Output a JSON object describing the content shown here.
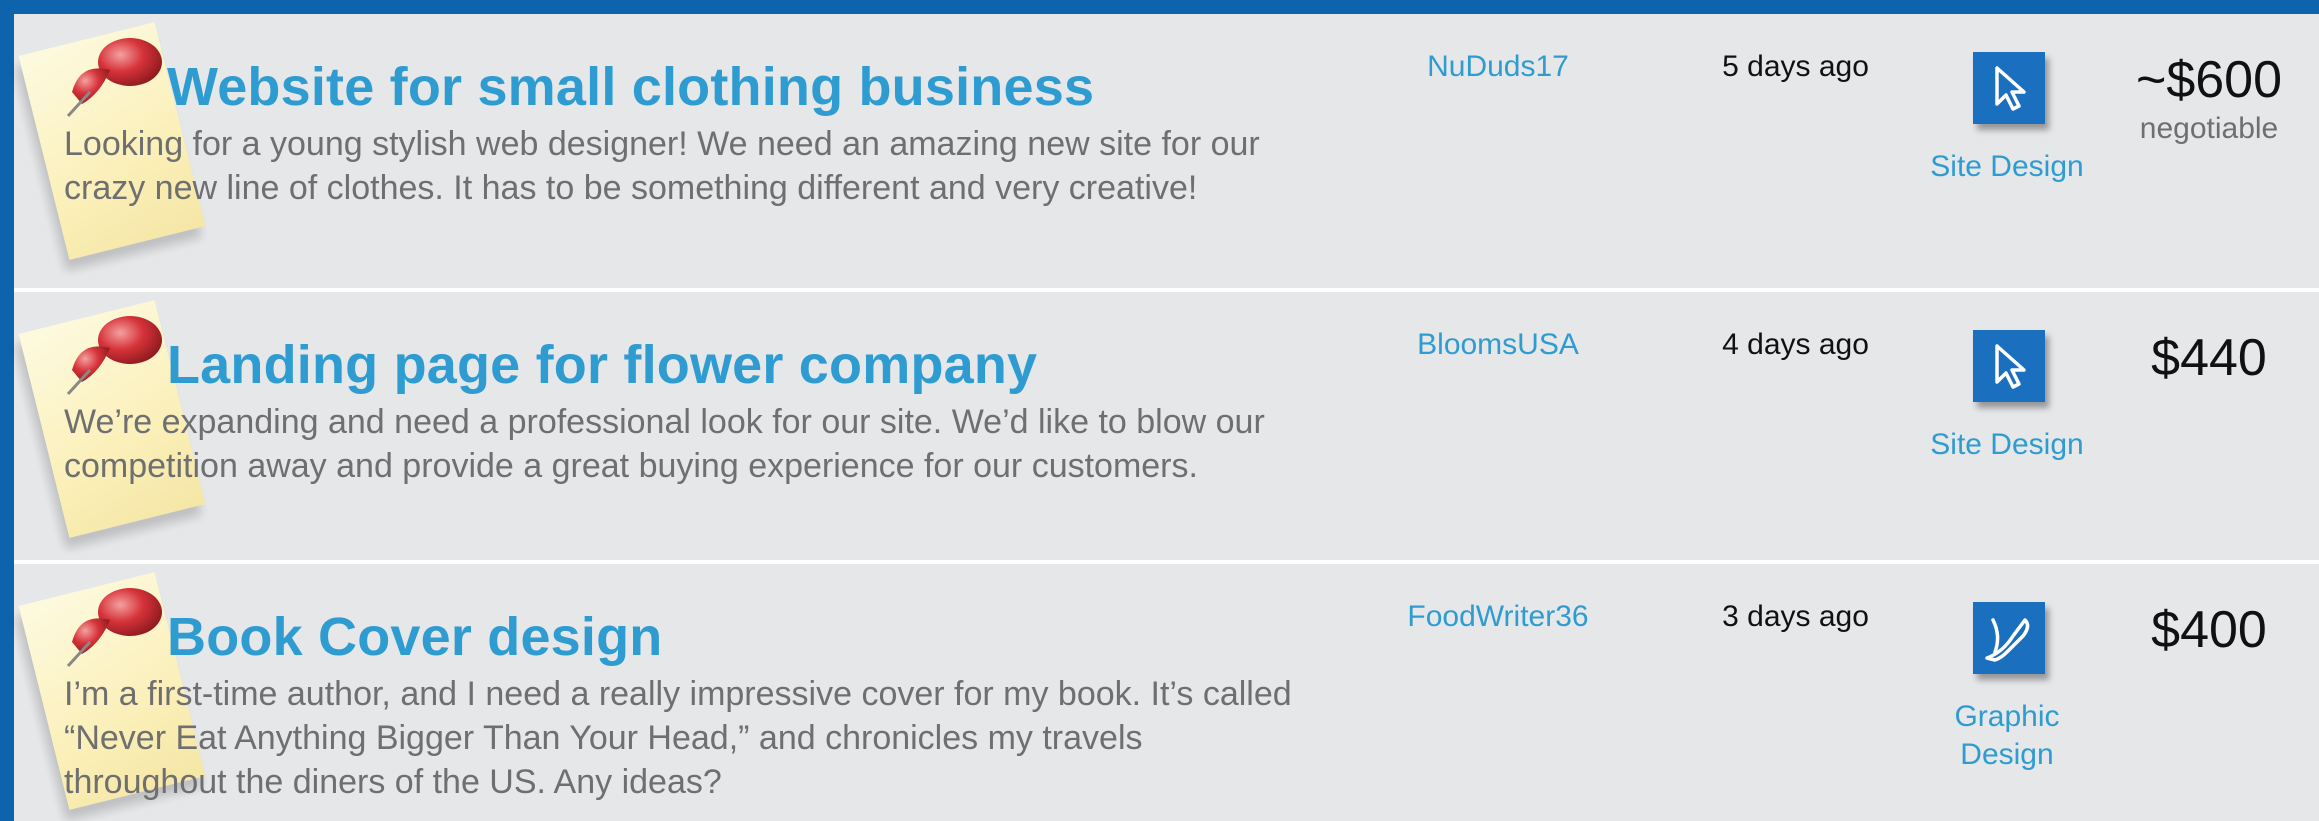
{
  "listings": [
    {
      "title": "Website for small clothing business",
      "description": "Looking for a young stylish web designer! We need an amazing new site for our crazy new line of clothes. It has to be something different and very creative!",
      "user": "NuDuds17",
      "posted": "5 days ago",
      "category": "Site Design",
      "category_icon": "cursor-arrow-icon",
      "price": "~$600",
      "price_note": "negotiable"
    },
    {
      "title": "Landing page for flower company",
      "description": "We’re expanding and need a professional look for our site. We’d like to blow our competition away and provide a great buying experience for our customers.",
      "user": "BloomsUSA",
      "posted": "4 days ago",
      "category": "Site Design",
      "category_icon": "cursor-arrow-icon",
      "price": "$440",
      "price_note": ""
    },
    {
      "title": "Book Cover design",
      "description": "I’m a first-time author, and I need a really impressive cover for my book. It’s called “Never Eat Anything Bigger Than Your Head,” and chronicles my travels throughout the diners of the US. Any ideas?",
      "user": "FoodWriter36",
      "posted": "3 days ago",
      "category": "Graphic Design",
      "category_icon": "pen-nib-icon",
      "price": "$400",
      "price_note": ""
    }
  ],
  "colors": {
    "frame": "#0e63ad",
    "row_bg": "#e6e7e9",
    "title": "#2f9cd1",
    "body_text": "#6f6f70",
    "icon_tile": "#1a6fbf"
  }
}
